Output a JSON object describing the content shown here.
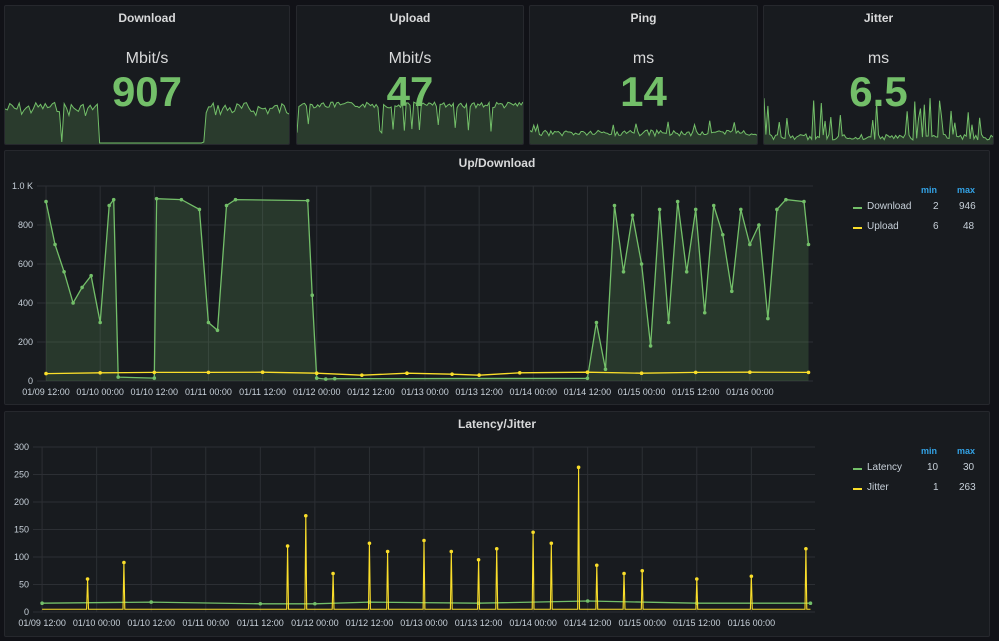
{
  "stats": [
    {
      "title": "Download",
      "unit": "Mbit/s",
      "value": "907",
      "spark": "download"
    },
    {
      "title": "Upload",
      "unit": "Mbit/s",
      "value": "47",
      "spark": "upload"
    },
    {
      "title": "Ping",
      "unit": "ms",
      "value": "14",
      "spark": "ping"
    },
    {
      "title": "Jitter",
      "unit": "ms",
      "value": "6.5",
      "spark": "jitter"
    }
  ],
  "colors": {
    "green": "#73bf69",
    "yellow": "#fade2a",
    "blue": "#33a2e5",
    "grid": "#2c2f34"
  },
  "updown": {
    "title": "Up/Download",
    "legend": {
      "min_label": "min",
      "max_label": "max",
      "items": [
        {
          "name": "Download",
          "min": "2",
          "max": "946",
          "color": "#73bf69"
        },
        {
          "name": "Upload",
          "min": "6",
          "max": "48",
          "color": "#fade2a"
        }
      ]
    }
  },
  "latency": {
    "title": "Latency/Jitter",
    "legend": {
      "min_label": "min",
      "max_label": "max",
      "items": [
        {
          "name": "Latency",
          "min": "10",
          "max": "30",
          "color": "#73bf69"
        },
        {
          "name": "Jitter",
          "min": "1",
          "max": "263",
          "color": "#fade2a"
        }
      ]
    }
  },
  "chart_data": [
    {
      "type": "line",
      "title": "Up/Download",
      "x_ticks": [
        "01/09 12:00",
        "01/10 00:00",
        "01/10 12:00",
        "01/11 00:00",
        "01/11 12:00",
        "01/12 00:00",
        "01/12 12:00",
        "01/13 00:00",
        "01/13 12:00",
        "01/14 00:00",
        "01/14 12:00",
        "01/15 00:00",
        "01/15 12:00",
        "01/16 00:00"
      ],
      "y_ticks": [
        "0",
        "200",
        "400",
        "600",
        "800",
        "1.0 K"
      ],
      "ylim": [
        0,
        1000
      ],
      "x_range_hours": [
        -2,
        170
      ],
      "series": [
        {
          "name": "Download",
          "color": "#73bf69",
          "points": [
            [
              0,
              920
            ],
            [
              2,
              700
            ],
            [
              4,
              560
            ],
            [
              6,
              400
            ],
            [
              8,
              480
            ],
            [
              10,
              540
            ],
            [
              12,
              300
            ],
            [
              14,
              900
            ],
            [
              15,
              930
            ],
            [
              16,
              20
            ],
            [
              24,
              15
            ],
            [
              24.5,
              935
            ],
            [
              30,
              930
            ],
            [
              34,
              880
            ],
            [
              36,
              300
            ],
            [
              38,
              260
            ],
            [
              40,
              900
            ],
            [
              42,
              930
            ],
            [
              58,
              925
            ],
            [
              59,
              440
            ],
            [
              60,
              15
            ],
            [
              62,
              10
            ],
            [
              64,
              12
            ],
            [
              120,
              14
            ],
            [
              122,
              300
            ],
            [
              124,
              60
            ],
            [
              126,
              900
            ],
            [
              128,
              560
            ],
            [
              130,
              850
            ],
            [
              132,
              600
            ],
            [
              134,
              180
            ],
            [
              136,
              880
            ],
            [
              138,
              300
            ],
            [
              140,
              920
            ],
            [
              142,
              560
            ],
            [
              144,
              880
            ],
            [
              146,
              350
            ],
            [
              148,
              900
            ],
            [
              150,
              750
            ],
            [
              152,
              460
            ],
            [
              154,
              880
            ],
            [
              156,
              700
            ],
            [
              158,
              800
            ],
            [
              160,
              320
            ],
            [
              162,
              880
            ],
            [
              164,
              930
            ],
            [
              168,
              920
            ],
            [
              169,
              700
            ]
          ]
        },
        {
          "name": "Upload",
          "color": "#fade2a",
          "points": [
            [
              0,
              38
            ],
            [
              12,
              42
            ],
            [
              24,
              44
            ],
            [
              36,
              44
            ],
            [
              48,
              45
            ],
            [
              60,
              40
            ],
            [
              70,
              30
            ],
            [
              80,
              40
            ],
            [
              90,
              35
            ],
            [
              96,
              30
            ],
            [
              105,
              42
            ],
            [
              120,
              45
            ],
            [
              132,
              40
            ],
            [
              144,
              44
            ],
            [
              156,
              45
            ],
            [
              169,
              44
            ]
          ]
        }
      ]
    },
    {
      "type": "line",
      "title": "Latency/Jitter",
      "x_ticks": [
        "01/09 12:00",
        "01/10 00:00",
        "01/10 12:00",
        "01/11 00:00",
        "01/11 12:00",
        "01/12 00:00",
        "01/12 12:00",
        "01/13 00:00",
        "01/13 12:00",
        "01/14 00:00",
        "01/14 12:00",
        "01/15 00:00",
        "01/15 12:00",
        "01/16 00:00"
      ],
      "y_ticks": [
        "0",
        "50",
        "100",
        "150",
        "200",
        "250",
        "300"
      ],
      "ylim": [
        0,
        300
      ],
      "x_range_hours": [
        -2,
        170
      ],
      "series": [
        {
          "name": "Latency",
          "color": "#73bf69",
          "points": [
            [
              0,
              16
            ],
            [
              24,
              18
            ],
            [
              48,
              15
            ],
            [
              60,
              15
            ],
            [
              72,
              18
            ],
            [
              96,
              16
            ],
            [
              120,
              20
            ],
            [
              144,
              16
            ],
            [
              169,
              16
            ]
          ]
        },
        {
          "name": "Jitter",
          "color": "#fade2a",
          "spikes": [
            [
              10,
              60
            ],
            [
              18,
              90
            ],
            [
              54,
              120
            ],
            [
              58,
              175
            ],
            [
              64,
              70
            ],
            [
              72,
              125
            ],
            [
              76,
              110
            ],
            [
              84,
              130
            ],
            [
              90,
              110
            ],
            [
              96,
              95
            ],
            [
              100,
              115
            ],
            [
              108,
              145
            ],
            [
              112,
              125
            ],
            [
              118,
              263
            ],
            [
              122,
              85
            ],
            [
              128,
              70
            ],
            [
              132,
              75
            ],
            [
              144,
              60
            ],
            [
              156,
              65
            ],
            [
              168,
              115
            ]
          ]
        }
      ]
    }
  ]
}
